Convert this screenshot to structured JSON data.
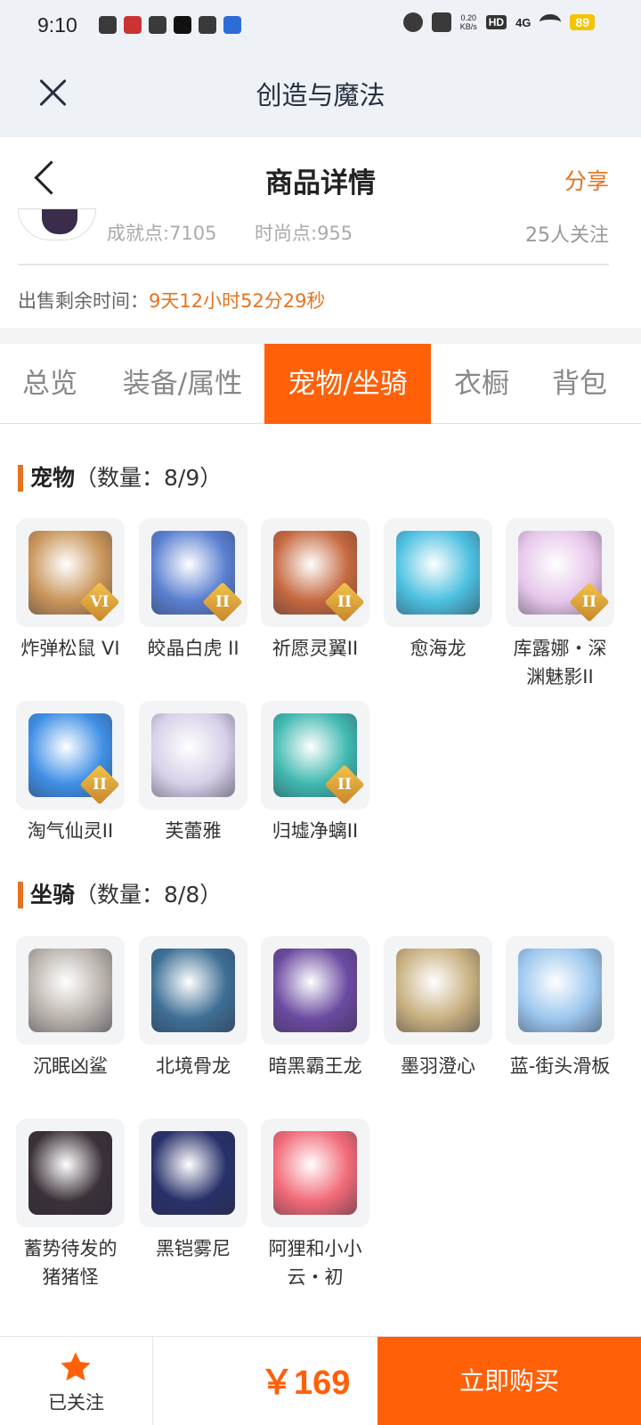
{
  "status": {
    "time": "9:10",
    "net": "0.20\nKB/s",
    "hd": "HD",
    "signal": "4G",
    "battery": "89"
  },
  "appbar": {
    "title": "创造与魔法"
  },
  "header": {
    "title": "商品详情",
    "share_label": "分享"
  },
  "info": {
    "achievement": "成就点:7105",
    "fashion": "时尚点:955",
    "followers": "25人关注",
    "sale_label": "出售剩余时间：",
    "sale_time": "9天12小时52分29秒"
  },
  "tabs": [
    {
      "label": "总览"
    },
    {
      "label": "装备/属性"
    },
    {
      "label": "宠物/坐骑",
      "active": true
    },
    {
      "label": "衣橱"
    },
    {
      "label": "背包"
    }
  ],
  "pets": {
    "title": "宠物",
    "count": "（数量：8/9）",
    "items": [
      {
        "name": "炸弹松鼠 VI",
        "rank": "VI",
        "color": "#c9955a"
      },
      {
        "name": "皎晶白虎 II",
        "rank": "II",
        "color": "#5a7fd0"
      },
      {
        "name": "祈愿灵翼II",
        "rank": "II",
        "color": "#c5683f"
      },
      {
        "name": "愈海龙",
        "rank": "",
        "color": "#4cc0e0"
      },
      {
        "name": "库露娜・深渊魅影II",
        "rank": "II",
        "color": "#e6c6ea"
      },
      {
        "name": "淘气仙灵II",
        "rank": "II",
        "color": "#3f8fe6"
      },
      {
        "name": "芙蕾雅",
        "rank": "",
        "color": "#d8d0e8"
      },
      {
        "name": "归墟净螭II",
        "rank": "II",
        "color": "#3fb8b0"
      }
    ]
  },
  "mounts": {
    "title": "坐骑",
    "count": "（数量：8/8）",
    "items": [
      {
        "name": "沉眠凶鲨",
        "color": "#b9b2ac"
      },
      {
        "name": "北境骨龙",
        "color": "#3e6f95"
      },
      {
        "name": "暗黑霸王龙",
        "color": "#6b4aa0"
      },
      {
        "name": "墨羽澄心",
        "color": "#c8b080"
      },
      {
        "name": "蓝-街头滑板",
        "color": "#9cc7ee"
      },
      {
        "name": "蓄势待发的猪猪怪",
        "color": "#3a3038"
      },
      {
        "name": "黑铠雾尼",
        "color": "#28306a"
      },
      {
        "name": "阿狸和小小云・初",
        "color": "#f26a78"
      }
    ]
  },
  "bottom": {
    "follow_label": "已关注",
    "price": "￥169",
    "buy_label": "立即购买"
  },
  "colors": {
    "accent": "#ff6008",
    "orange_text": "#e4731f"
  }
}
